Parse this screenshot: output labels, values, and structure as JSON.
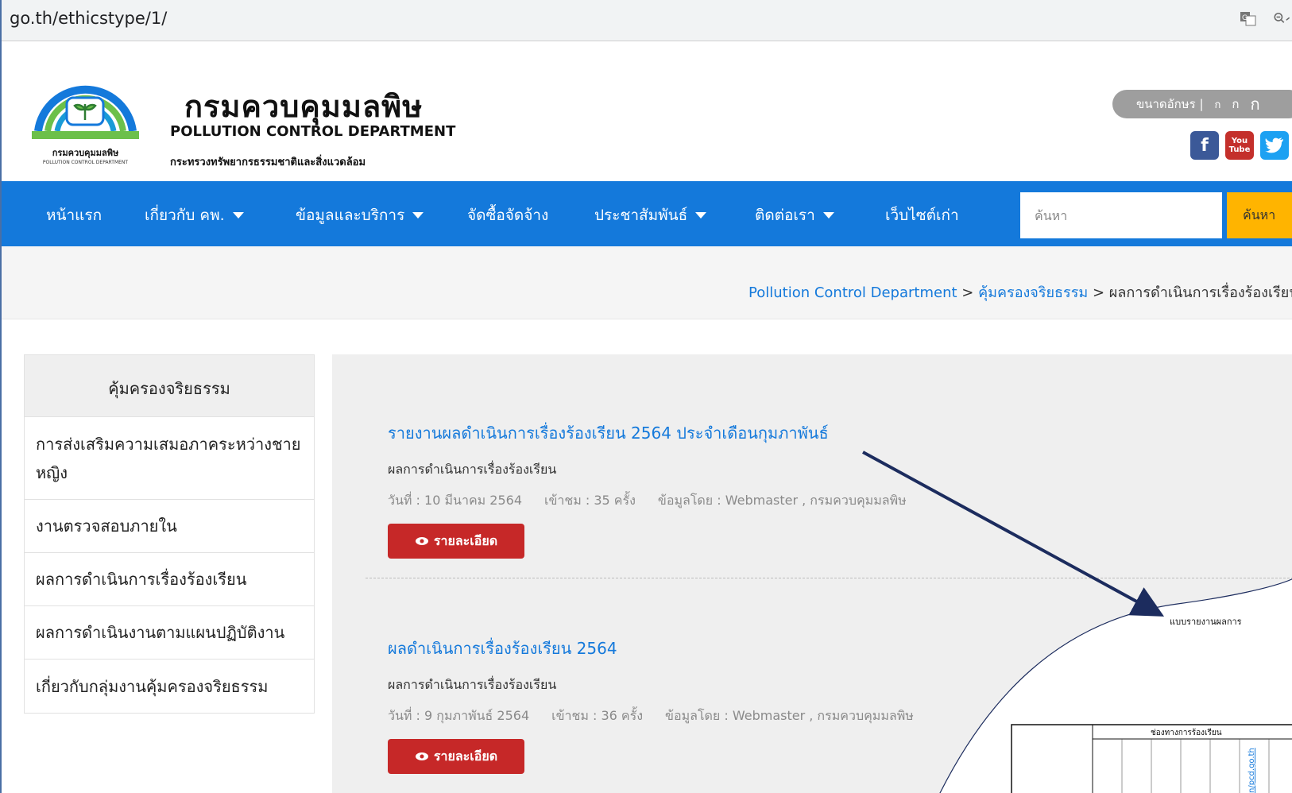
{
  "browser": {
    "url": "go.th/ethicstype/1/",
    "tools": [
      "translate-icon",
      "zoom-icon"
    ]
  },
  "header": {
    "org_name_th": "กรมควบคุมมลพิษ",
    "org_name_en": "POLLUTION CONTROL DEPARTMENT",
    "ministry_th": "กระทรวงทรัพยากรธรรมชาติและสิ่งแวดล้อม",
    "logo_caption_th": "กรมควบคุมมลพิษ",
    "logo_caption_en": "POLLUTION CONTROL DEPARTMENT",
    "font_size_label": "ขนาดอักษร |",
    "font_size_options": [
      "ก",
      "ก",
      "ก"
    ],
    "social": [
      "facebook-icon",
      "youtube-icon",
      "twitter-icon"
    ],
    "youtube_top": "You",
    "youtube_bottom": "Tube"
  },
  "nav": {
    "items": [
      {
        "label": "หน้าแรก",
        "dropdown": false
      },
      {
        "label": "เกี่ยวกับ คพ.",
        "dropdown": true
      },
      {
        "label": "ข้อมูลและบริการ",
        "dropdown": true
      },
      {
        "label": "จัดซื้อจัดจ้าง",
        "dropdown": false
      },
      {
        "label": "ประชาสัมพันธ์",
        "dropdown": true
      },
      {
        "label": "ติดต่อเรา",
        "dropdown": true
      },
      {
        "label": "เว็บไซต์เก่า",
        "dropdown": false
      }
    ],
    "search_placeholder": "ค้นหา",
    "search_button": "ค้นหา"
  },
  "breadcrumb": {
    "home": "Pollution Control Department",
    "sep": " > ",
    "parent": "คุ้มครองจริยธรรม",
    "current": "ผลการดำเนินการเรื่องร้องเรียน"
  },
  "sidebar": {
    "title": "คุ้มครองจริยธรรม",
    "items": [
      "การส่งเสริมความเสมอภาคระหว่างชายหญิง",
      "งานตรวจสอบภายใน",
      "ผลการดำเนินการเรื่องร้องเรียน",
      "ผลการดำเนินงานตามแผนปฏิบัติงาน",
      "เกี่ยวกับกลุ่มงานคุ้มครองจริยธรรม"
    ]
  },
  "posts": [
    {
      "title": "รายงานผลดำเนินการเรื่องร้องเรียน 2564 ประจำเดือนกุมภาพันธ์",
      "category": "ผลการดำเนินการเรื่องร้องเรียน",
      "date": "วันที่ : 10 มีนาคม 2564",
      "views": "เข้าชม : 35 ครั้ง",
      "author": "ข้อมูลโดย : Webmaster , กรมควบคุมมลพิษ",
      "button": "รายละเอียด"
    },
    {
      "title": "ผลดำเนินการเรื่องร้องเรียน 2564",
      "category": "ผลการดำเนินการเรื่องร้องเรียน",
      "date": "วันที่ : 9 กุมภาพันธ์ 2564",
      "views": "เข้าชม : 36 ครั้ง",
      "author": "ข้อมูลโดย : Webmaster , กรมควบคุมมลพิษ",
      "button": "รายละเอียด"
    }
  ],
  "overlay": {
    "doc_heading": "แบบรายงานผลการ",
    "table_header": "ช่องทางการร้องเรียน",
    "vertical_text": "n/pcd.go.th",
    "arrow_color": "#1c2c5e"
  },
  "colors": {
    "nav_blue": "#1479db",
    "detail_red": "#c62828",
    "search_yellow": "#ffb400"
  }
}
